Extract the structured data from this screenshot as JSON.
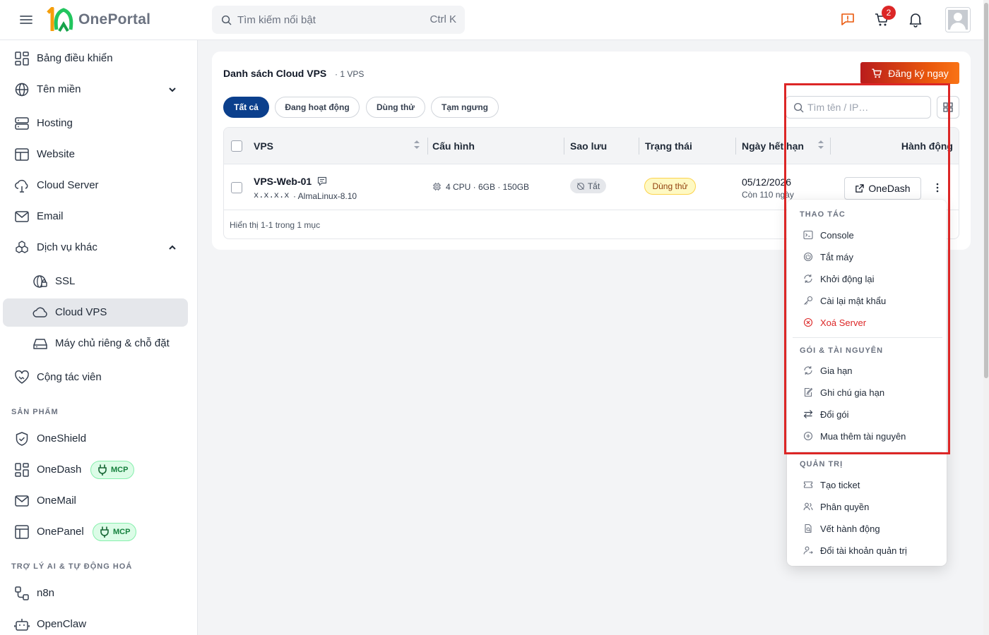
{
  "topbar": {
    "brand": "OnePortal",
    "search_placeholder": "Tìm kiếm nổi bật",
    "search_shortcut": "Ctrl K",
    "cart_count": "2",
    "icons": [
      "menu-icon",
      "feedback-icon",
      "cart-icon",
      "bell-icon",
      "avatar"
    ]
  },
  "sidebar": {
    "items": [
      {
        "label": "Bảng điều khiển",
        "icon": "dashboard-icon"
      },
      {
        "label": "Tên miền",
        "icon": "globe-icon"
      },
      {
        "label": "Hosting",
        "icon": "server-icon"
      },
      {
        "label": "Website",
        "icon": "website-icon"
      },
      {
        "label": "Cloud Server",
        "icon": "cloud-server-icon"
      },
      {
        "label": "Email",
        "icon": "mail-icon"
      },
      {
        "label": "Dịch vụ khác",
        "icon": "boxes-icon"
      },
      {
        "label": "SSL",
        "icon": "ssl-icon"
      },
      {
        "label": "Cloud VPS",
        "icon": "cloud-icon"
      },
      {
        "label": "Máy chủ riêng & chỗ đặt",
        "icon": "hard-drive-icon"
      },
      {
        "label": "Cộng tác viên",
        "icon": "handshake-icon"
      }
    ],
    "section_products": "SẢN PHẨM",
    "products": [
      {
        "label": "OneShield",
        "icon": "shield-icon"
      },
      {
        "label": "OneDash",
        "icon": "dashboard-icon",
        "badge": "MCP"
      },
      {
        "label": "OneMail",
        "icon": "mail-icon"
      },
      {
        "label": "OnePanel",
        "icon": "panel-icon",
        "badge": "MCP"
      }
    ],
    "section_ai": "TRỢ LÝ AI & TỰ ĐỘNG HOÁ",
    "ai": [
      {
        "label": "n8n",
        "icon": "workflow-icon"
      },
      {
        "label": "OpenClaw",
        "icon": "bot-icon"
      }
    ]
  },
  "main": {
    "title": "Danh sách Cloud VPS",
    "count": "· 1 VPS",
    "register_label": "Đăng ký ngay",
    "filters": [
      "Tất cả",
      "Đang hoạt động",
      "Dùng thử",
      "Tạm ngưng"
    ],
    "filter_search_placeholder": "Tìm tên / IP…",
    "table": {
      "columns": [
        "VPS",
        "Cấu hình",
        "Sao lưu",
        "Trạng thái",
        "Ngày hết hạn",
        "Hành động"
      ],
      "rows": [
        {
          "name": "VPS-Web-01",
          "ip": "x.x.x.x",
          "os": "· AlmaLinux-8.10",
          "config": "4 CPU · 6GB · 150GB",
          "backup": "Tắt",
          "status": "Dùng thử",
          "expiry": "05/12/2026",
          "remaining": "Còn 110 ngày",
          "action": "OneDash"
        }
      ],
      "footer": "Hiển thị 1-1 trong 1 mục"
    }
  },
  "menu": {
    "section1": "THAO TÁC",
    "actions": [
      {
        "label": "Console",
        "icon": "console-icon"
      },
      {
        "label": "Tắt máy",
        "icon": "power-icon"
      },
      {
        "label": "Khởi động lại",
        "icon": "restart-icon"
      },
      {
        "label": "Cài lại mật khẩu",
        "icon": "key-icon"
      },
      {
        "label": "Xoá Server",
        "icon": "delete-icon"
      }
    ],
    "section2": "GÓI & TÀI NGUYÊN",
    "resources": [
      {
        "label": "Gia hạn",
        "icon": "renew-icon"
      },
      {
        "label": "Ghi chú gia hạn",
        "icon": "note-icon"
      },
      {
        "label": "Đổi gói",
        "icon": "swap-icon"
      },
      {
        "label": "Mua thêm tài nguyên",
        "icon": "plus-circle-icon"
      }
    ],
    "section3": "QUẢN TRỊ",
    "admin": [
      {
        "label": "Tạo ticket",
        "icon": "ticket-icon"
      },
      {
        "label": "Phân quyền",
        "icon": "users-icon"
      },
      {
        "label": "Vết hành động",
        "icon": "audit-icon"
      },
      {
        "label": "Đổi tài khoản quản trị",
        "icon": "user-switch-icon"
      }
    ]
  },
  "colors": {
    "accent": "#0b3f8c",
    "danger": "#dc2626",
    "register_gradient_start": "#b91c1c",
    "register_gradient_end": "#f97316",
    "mcp_bg": "#dcfce7",
    "mcp_text": "#15803d",
    "trial_bg": "#fef9c3",
    "highlight_border": "#dc2626"
  }
}
